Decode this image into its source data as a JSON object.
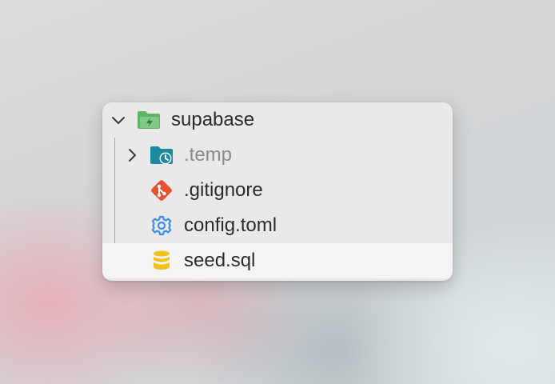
{
  "tree": {
    "root": {
      "label": "supabase",
      "expanded": true,
      "icon": "folder-supabase-icon"
    },
    "items": [
      {
        "label": ".temp",
        "type": "folder",
        "expanded": false,
        "dimmed": true,
        "icon": "folder-clock-icon"
      },
      {
        "label": ".gitignore",
        "type": "file",
        "icon": "git-icon"
      },
      {
        "label": "config.toml",
        "type": "file",
        "icon": "gear-icon"
      },
      {
        "label": "seed.sql",
        "type": "file",
        "selected": true,
        "icon": "database-icon"
      }
    ]
  },
  "colors": {
    "supabase_folder": "#5cb466",
    "temp_folder": "#1b8a9e",
    "git": "#e8512f",
    "gear": "#3b8ee8",
    "database": "#f1c21b"
  }
}
